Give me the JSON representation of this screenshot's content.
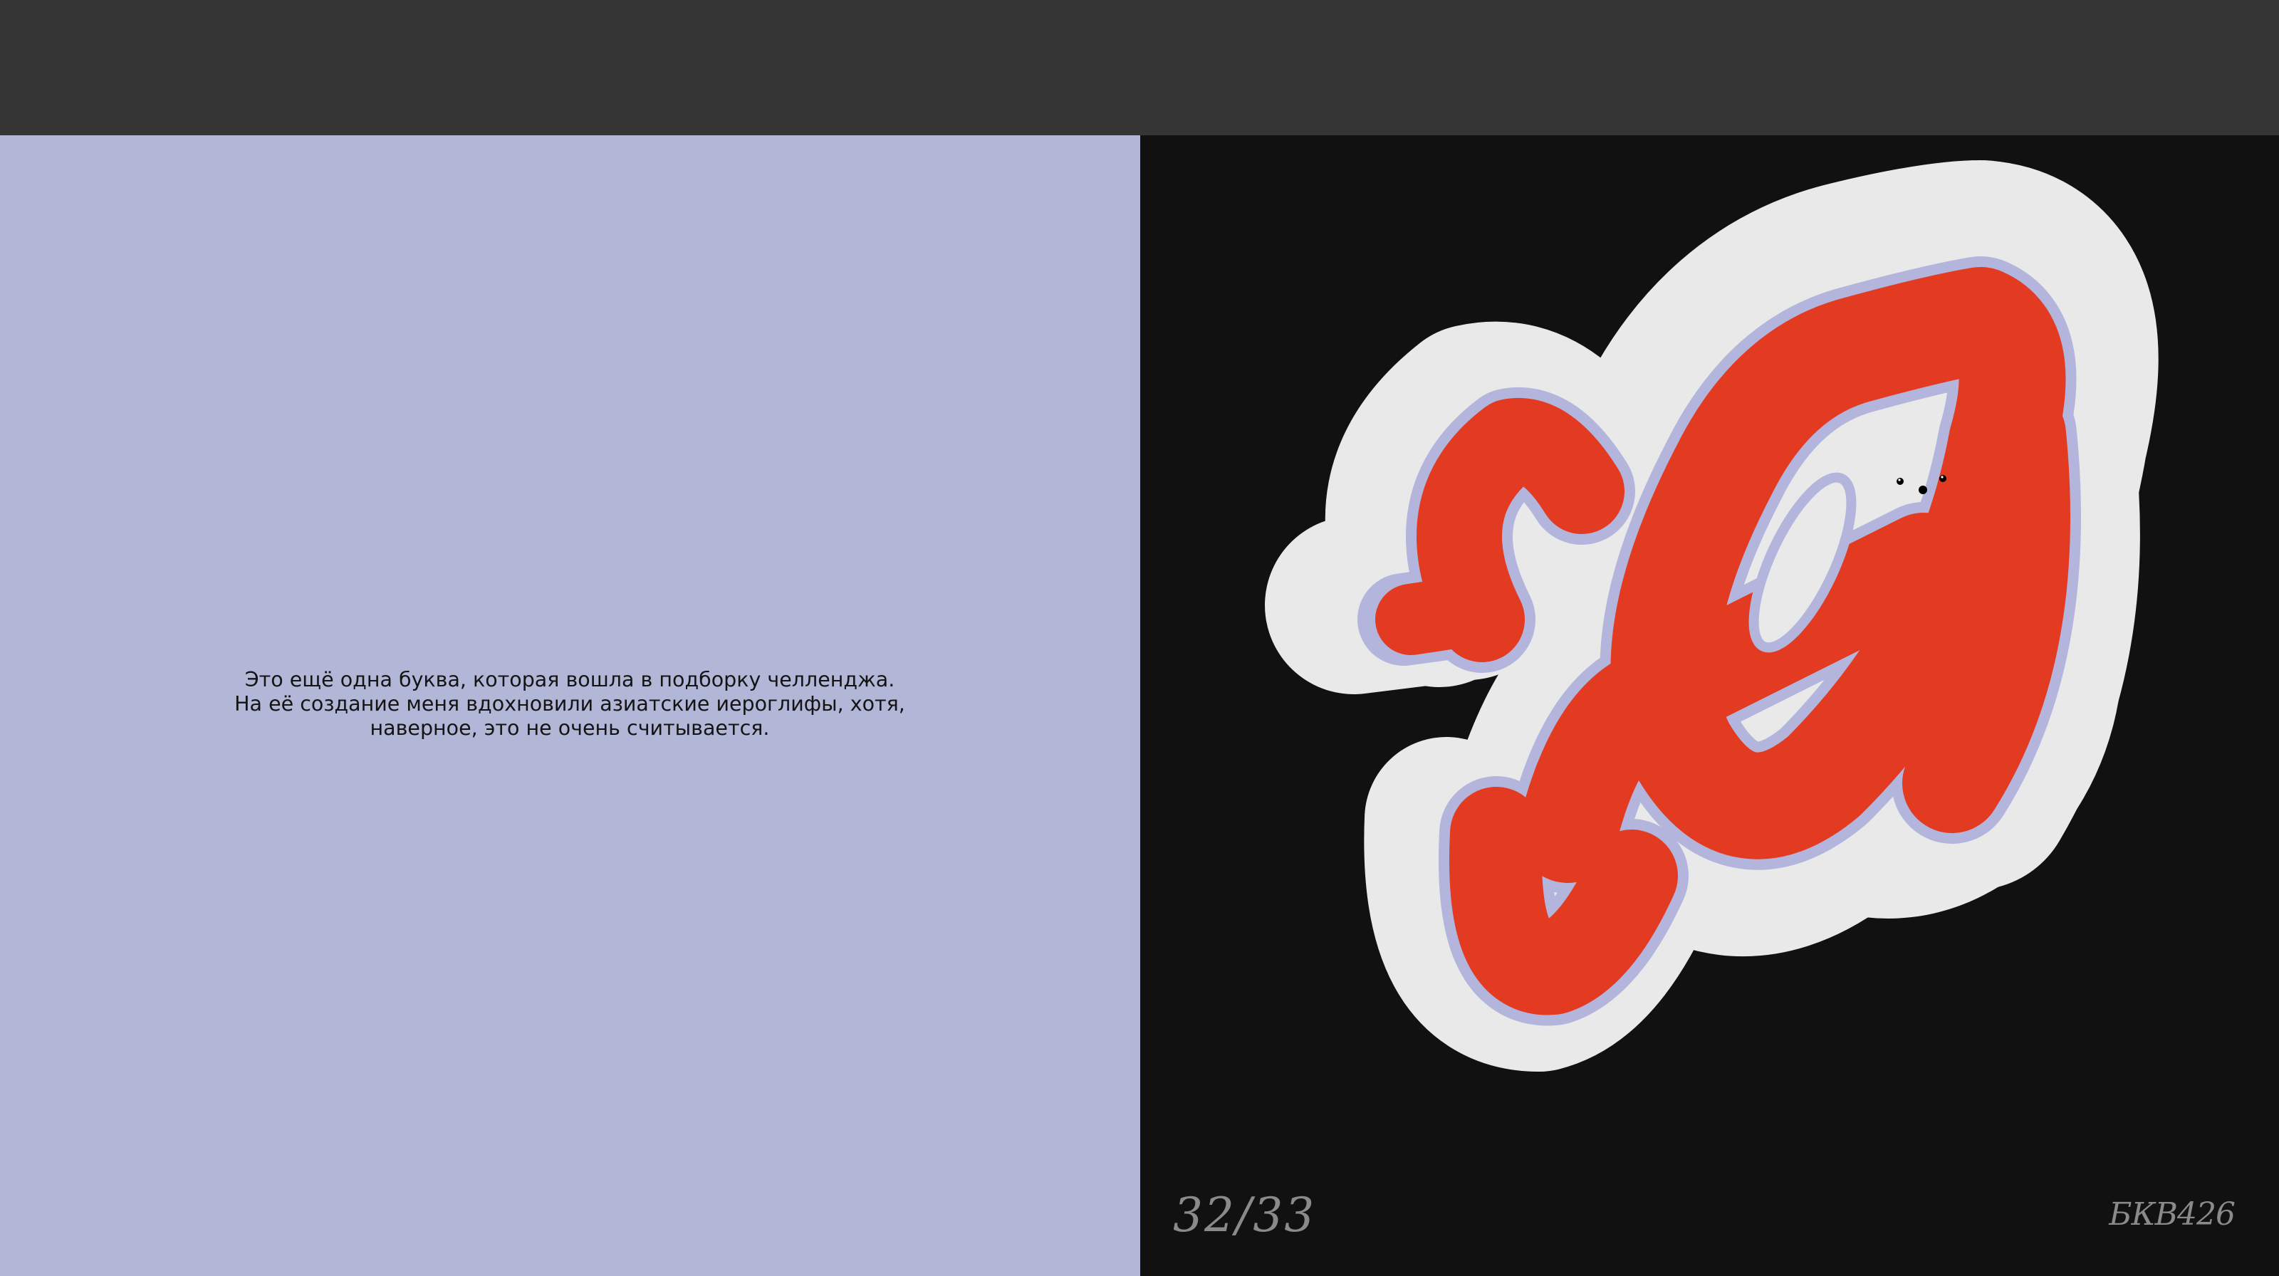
{
  "viewer": {
    "toolbar_background": "#353535"
  },
  "left_page": {
    "background": "#b3b7d7",
    "description_lines": [
      "Это ещё одна буква, которая вошла в подборку челленджа.",
      "На её создание меня вдохновили азиатские иероглифы, хотя,",
      "наверное, это не очень считывается."
    ]
  },
  "right_page": {
    "background": "#111111",
    "artwork": {
      "outline_color": "#e9e9e9",
      "stroke_color": "#b3b5dc",
      "fill_color": "#e33b22",
      "eye_color": "#000000"
    },
    "page_number": "32/33",
    "signature": "БКВ426"
  }
}
